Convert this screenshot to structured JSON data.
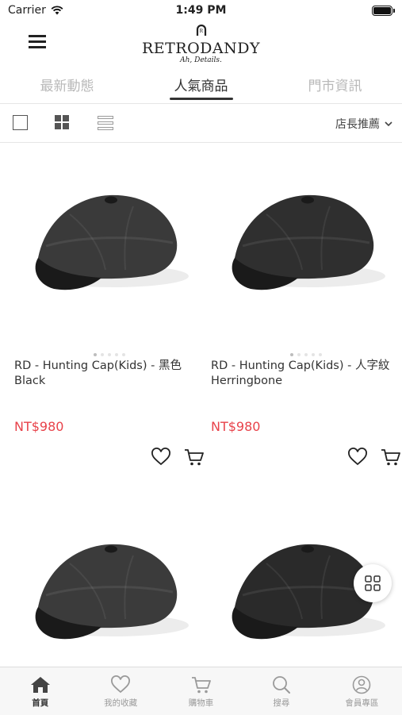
{
  "status_bar": {
    "carrier": "Carrier",
    "time": "1:49 PM"
  },
  "header": {
    "logo_text": "RETRODANDY",
    "logo_tagline": "Ah, Details."
  },
  "tabs": [
    {
      "label": "最新動態",
      "active": false
    },
    {
      "label": "人氣商品",
      "active": true
    },
    {
      "label": "門市資訊",
      "active": false
    }
  ],
  "toolbar": {
    "sort_label": "店長推薦"
  },
  "products": [
    {
      "name": "RD - Hunting Cap(Kids) - 黑色 Black",
      "price": "NT$980",
      "cap_color": "#3a3a3a"
    },
    {
      "name": "RD - Hunting Cap(Kids) - 人字紋 Herringbone",
      "price": "NT$980",
      "cap_color": "#2f2f2f"
    },
    {
      "name": "",
      "price": "",
      "cap_color": "#3b3b3b"
    },
    {
      "name": "",
      "price": "",
      "cap_color": "#2a2a2a"
    }
  ],
  "bottom_nav": [
    {
      "label": "首頁",
      "icon": "home-icon",
      "active": true
    },
    {
      "label": "我的收藏",
      "icon": "heart-icon",
      "active": false
    },
    {
      "label": "購物車",
      "icon": "cart-icon",
      "active": false
    },
    {
      "label": "搜尋",
      "icon": "search-icon",
      "active": false
    },
    {
      "label": "會員專區",
      "icon": "user-icon",
      "active": false
    }
  ],
  "colors": {
    "price": "#e8424a",
    "active_text": "#333333",
    "inactive_text": "#b9b9b9"
  }
}
